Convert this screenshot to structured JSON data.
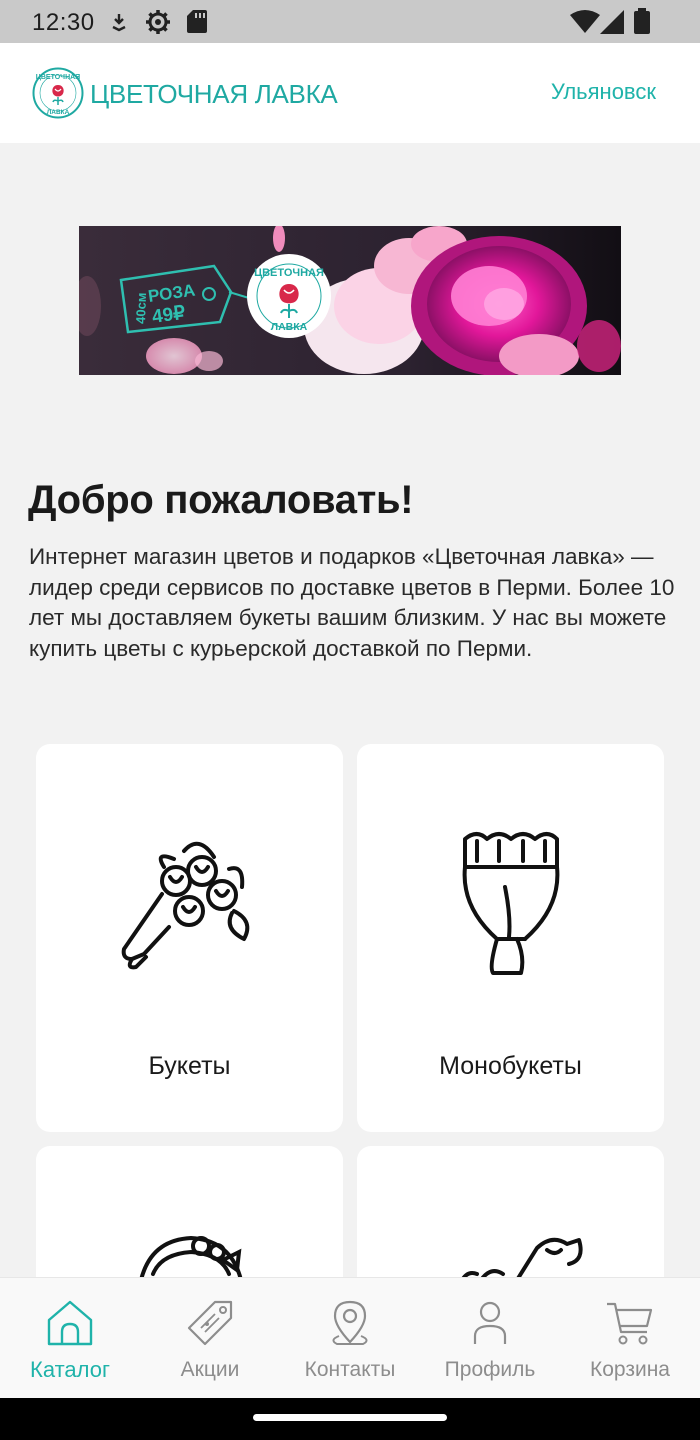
{
  "status_bar": {
    "time": "12:30",
    "icons": [
      "download-icon",
      "settings-icon",
      "sd-card-icon",
      "wifi-icon",
      "signal-icon",
      "battery-icon"
    ]
  },
  "header": {
    "logo_text": "ЦВЕТОЧНАЯ ЛАВКА",
    "logo_badge_top": "ЦВЕТОЧНАЯ",
    "logo_badge_bottom": "ЛАВКА",
    "city": "Ульяновск"
  },
  "banner": {
    "tag_size": "40см",
    "tag_name": "РОЗА",
    "tag_price": "49₽",
    "logo_top": "ЦВЕТОЧНАЯ",
    "logo_bottom": "ЛАВКА"
  },
  "welcome": {
    "title": "Добро пожаловать!",
    "text": "Интернет магазин цветов и подарков «Цветочная лавка» — лидер среди сервисов по доставке цветов в Перми. Более 10 лет мы доставляем букеты вашим близким. У нас вы можете купить цветы с курьерской доставкой по Перми."
  },
  "catalog": {
    "cards": [
      {
        "label": "Букеты",
        "icon": "bouquet-icon"
      },
      {
        "label": "Монобукеты",
        "icon": "monobouquet-icon"
      },
      {
        "label": "",
        "icon": "flower-wreath-icon"
      },
      {
        "label": "",
        "icon": "flower-gift-icon"
      }
    ]
  },
  "nav": {
    "items": [
      {
        "label": "Каталог",
        "icon": "home-icon",
        "active": true
      },
      {
        "label": "Акции",
        "icon": "tag-icon",
        "active": false
      },
      {
        "label": "Контакты",
        "icon": "location-pin-icon",
        "active": false
      },
      {
        "label": "Профиль",
        "icon": "person-icon",
        "active": false
      },
      {
        "label": "Корзина",
        "icon": "cart-icon",
        "active": false
      }
    ]
  },
  "colors": {
    "accent": "#1fb3aa",
    "brand_red": "#d8284a",
    "background": "#f2f2f2",
    "inactive": "#8d8d8d"
  }
}
